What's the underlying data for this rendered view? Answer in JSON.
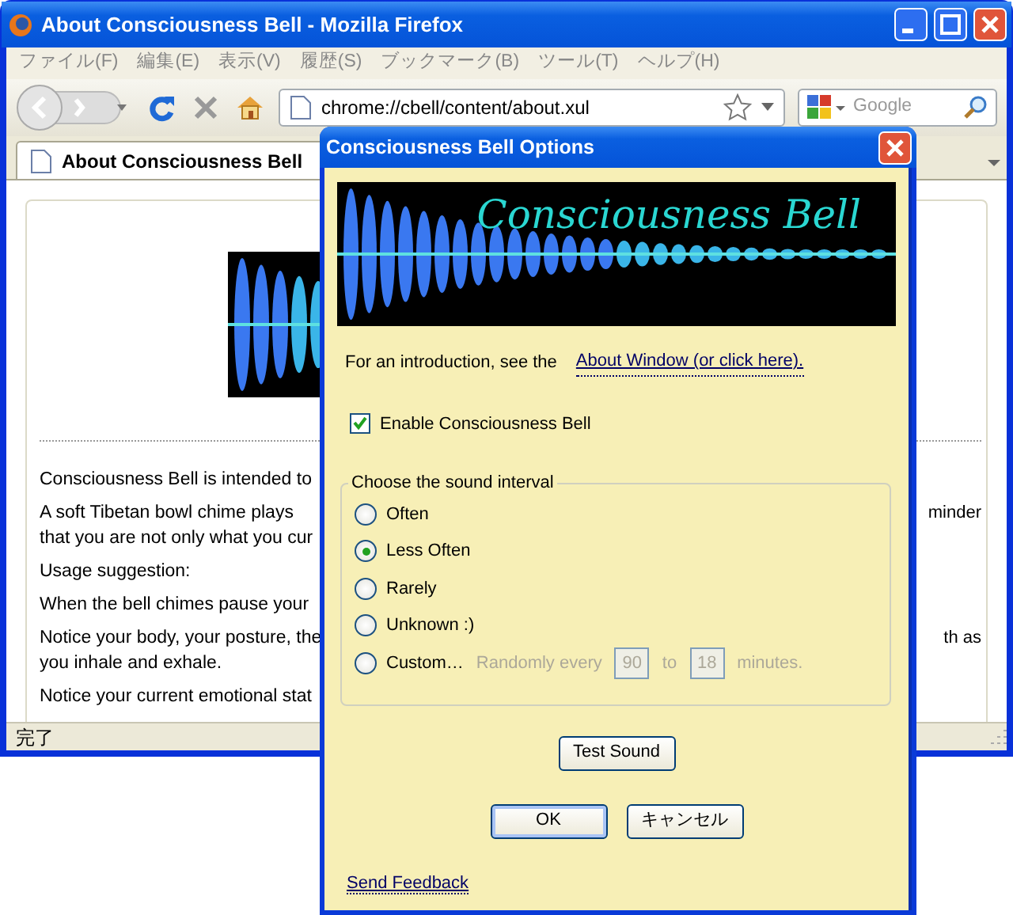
{
  "browser": {
    "title": "About Consciousness Bell - Mozilla Firefox",
    "menu": [
      "ファイル(F)",
      "編集(E)",
      "表示(V)",
      "履歴(S)",
      "ブックマーク(B)",
      "ツール(T)",
      "ヘルプ(H)"
    ],
    "address": "chrome://cbell/content/about.xul",
    "search_placeholder": "Google",
    "tab": "About Consciousness Bell",
    "paragraphs": [
      {
        "lines": [
          {
            "text": "Consciousness Bell is intended to"
          }
        ]
      },
      {
        "lines": [
          {
            "text": "A soft Tibetan bowl chime plays",
            "right": "minder"
          },
          {
            "text": "that you are not only what you cur"
          }
        ]
      },
      {
        "lines": [
          {
            "text": "Usage suggestion:"
          }
        ]
      },
      {
        "lines": [
          {
            "text": "When the bell chimes pause your"
          }
        ]
      },
      {
        "lines": [
          {
            "text": "Notice your body, your posture, the",
            "right": "th as"
          },
          {
            "text": "you inhale and exhale."
          }
        ]
      },
      {
        "lines": [
          {
            "text": "Notice your current emotional stat"
          }
        ]
      }
    ],
    "status": "完了"
  },
  "dialog": {
    "title": "Consciousness Bell Options",
    "banner": "Consciousness Bell",
    "intro": "For an introduction, see the",
    "intro_link": "About Window (or click here).",
    "enable": {
      "label": "Enable Consciousness Bell",
      "checked": true
    },
    "group": "Choose the sound interval",
    "options": [
      {
        "label": "Often",
        "selected": false
      },
      {
        "label": "Less Often",
        "selected": true
      },
      {
        "label": "Rarely",
        "selected": false
      },
      {
        "label": "Unknown :)",
        "selected": false
      },
      {
        "label": "Custom…",
        "selected": false
      }
    ],
    "custom": {
      "prefix": "Randomly every",
      "from": "90",
      "to_label": "to",
      "to": "18",
      "suffix": "minutes.",
      "disabled": true
    },
    "test_button": "Test Sound",
    "ok": "OK",
    "cancel": "キャンセル",
    "feedback": "Send Feedback"
  }
}
